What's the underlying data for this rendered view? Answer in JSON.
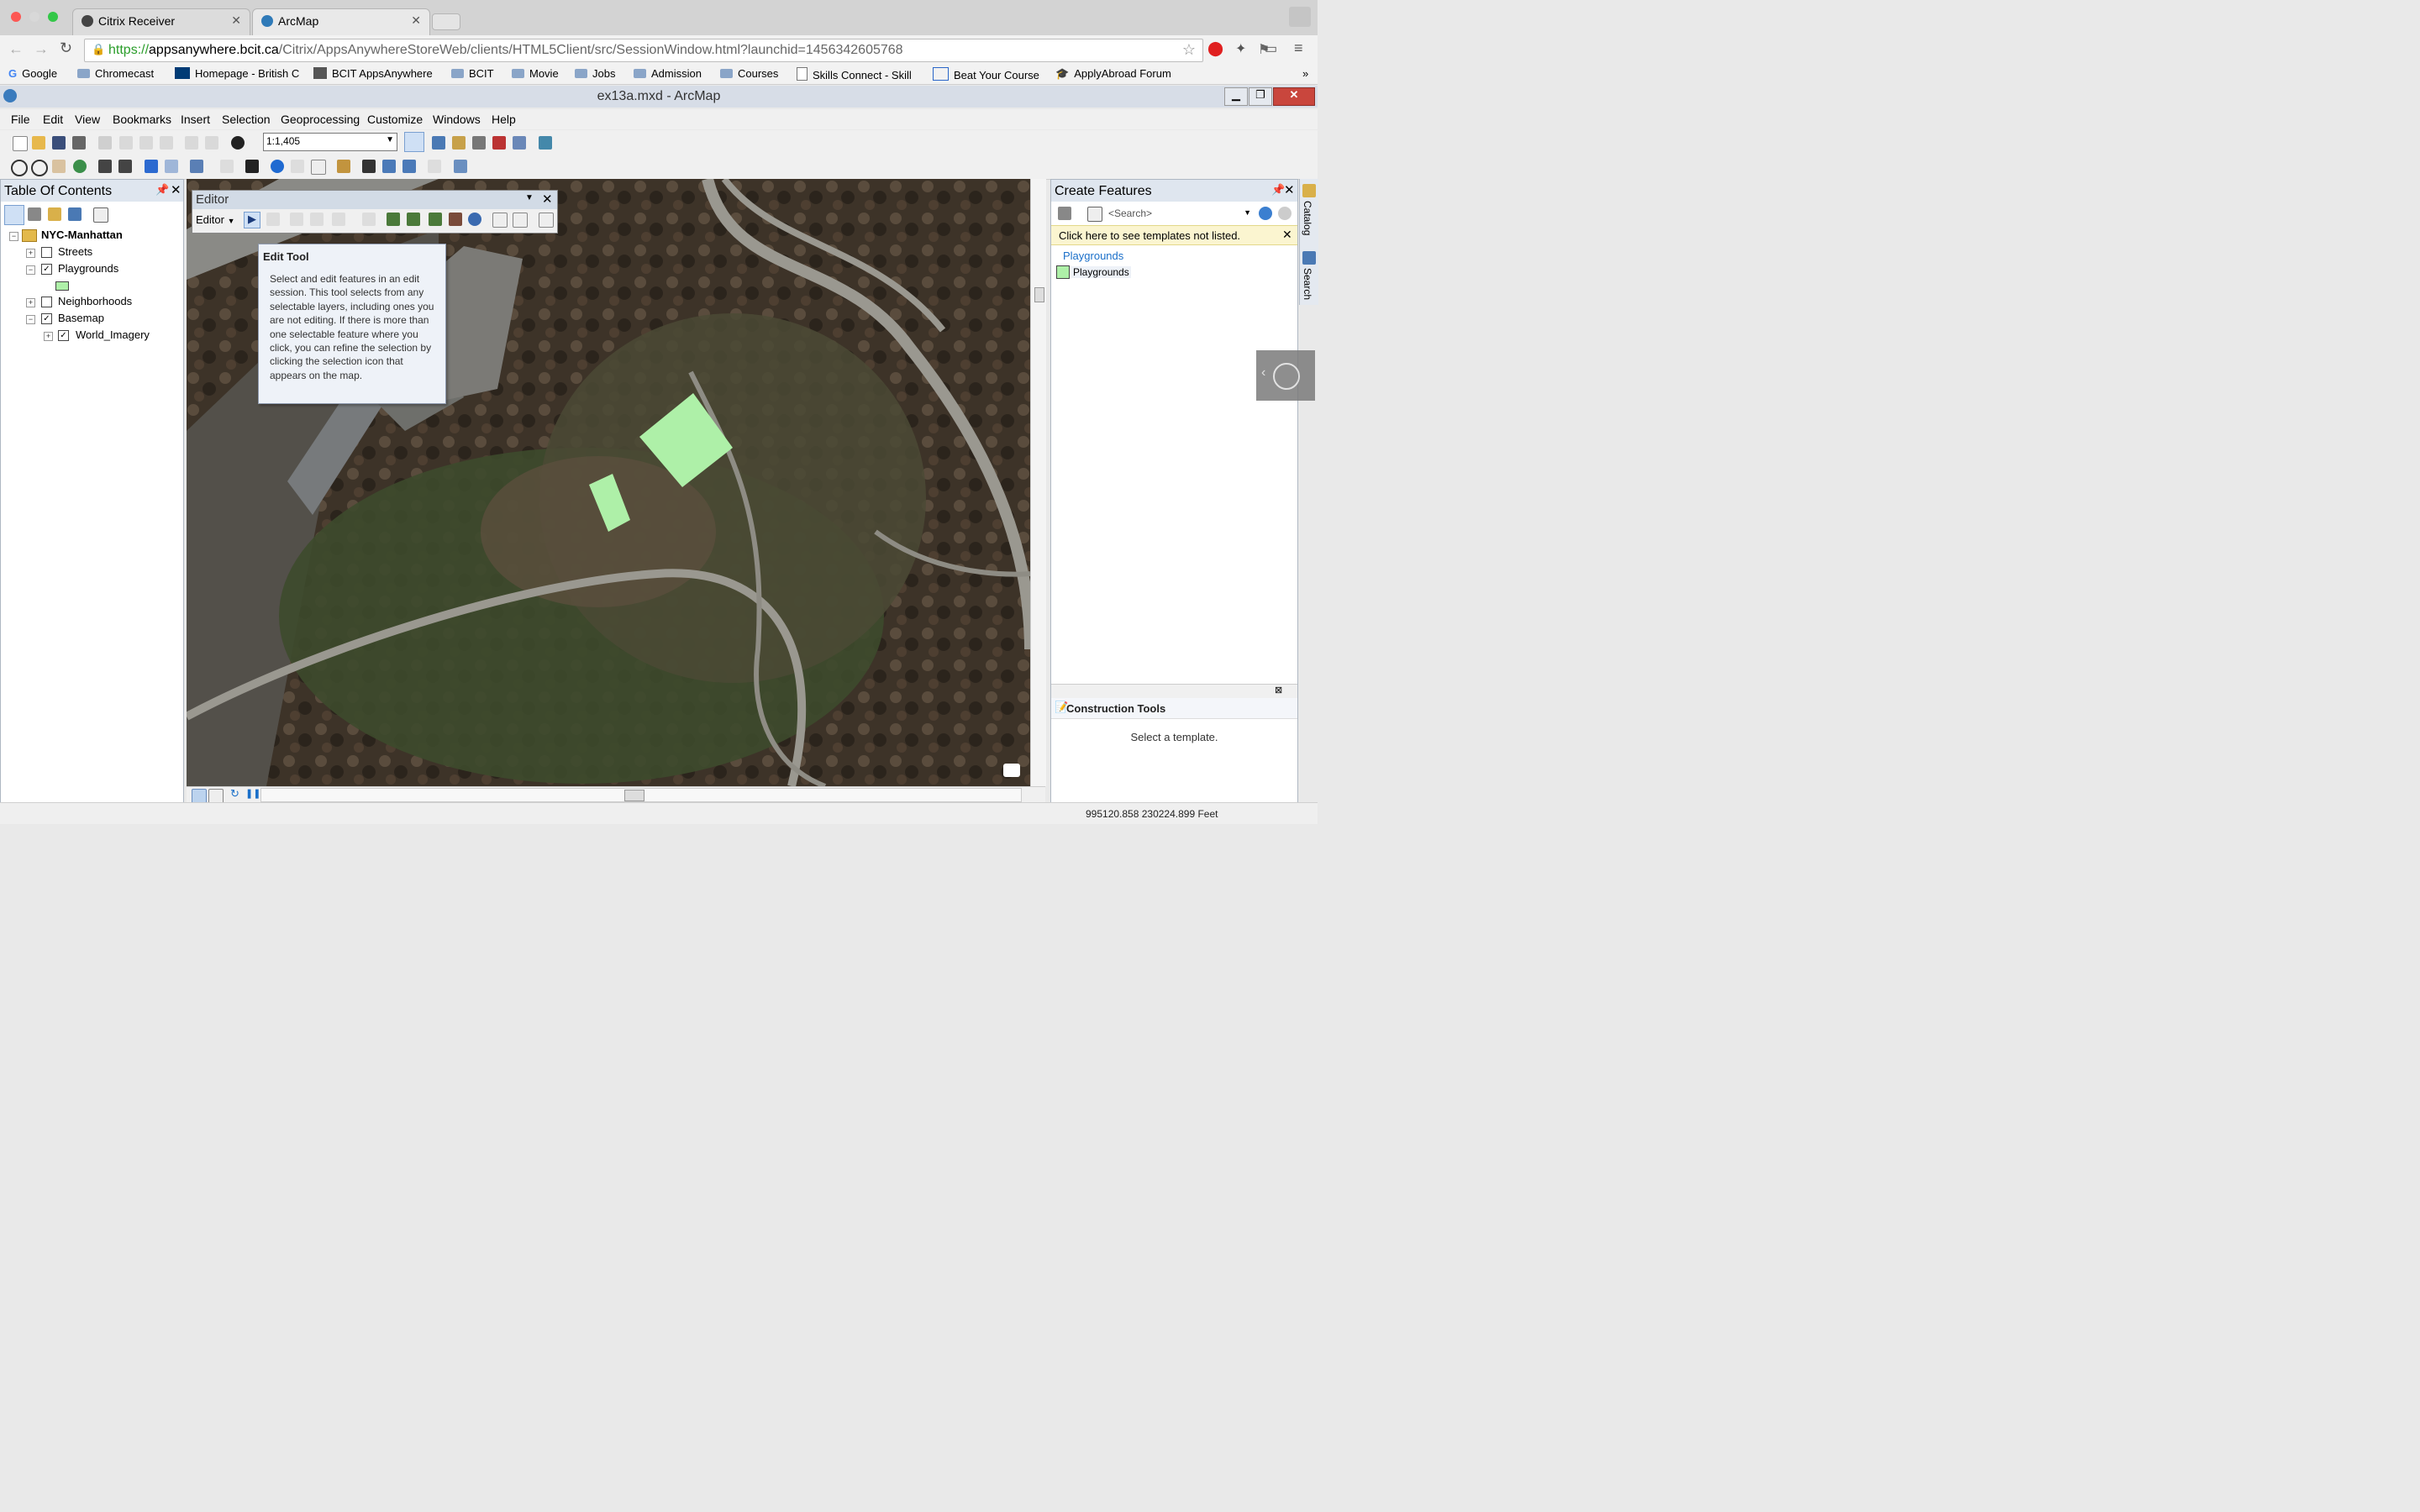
{
  "browser": {
    "tabs": [
      {
        "label": "Citrix Receiver"
      },
      {
        "label": "ArcMap"
      }
    ],
    "url": {
      "scheme": "https://",
      "host": "appsanywhere.bcit.ca",
      "path": "/Citrix/AppsAnywhereStoreWeb/clients/HTML5Client/src/SessionWindow.html?launchid=1456342605768"
    },
    "bookmarks": [
      "Google",
      "Chromecast",
      "Homepage - British C",
      "BCIT AppsAnywhere",
      "BCIT",
      "Movie",
      "Jobs",
      "Admission",
      "Courses",
      "Skills Connect - Skill",
      "Beat Your Course",
      "ApplyAbroad Forum"
    ],
    "overflow": "»"
  },
  "app": {
    "title": "ex13a.mxd - ArcMap",
    "menus": [
      "File",
      "Edit",
      "View",
      "Bookmarks",
      "Insert",
      "Selection",
      "Geoprocessing",
      "Customize",
      "Windows",
      "Help"
    ],
    "scale": "1:1,405"
  },
  "toc": {
    "title": "Table Of Contents",
    "root": "NYC-Manhattan",
    "layers": [
      {
        "name": "Streets",
        "checked": false
      },
      {
        "name": "Playgrounds",
        "checked": true
      },
      {
        "name": "Neighborhoods",
        "checked": false
      },
      {
        "name": "Basemap",
        "checked": true
      },
      {
        "name": "World_Imagery",
        "checked": true
      }
    ]
  },
  "editor": {
    "title": "Editor",
    "menu_label": "Editor",
    "tooltip_title": "Edit Tool",
    "tooltip_body": "Select and edit features in an edit session. This tool selects from any selectable layers, including ones you are not editing. If there is more than one selectable feature where you click, you can refine the selection by clicking the selection icon that appears on the map."
  },
  "create_features": {
    "title": "Create Features",
    "search_placeholder": "<Search>",
    "notice": "Click here to see templates not listed.",
    "group": "Playgrounds",
    "template": "Playgrounds",
    "construction_title": "Construction Tools",
    "construction_hint": "Select a template."
  },
  "side_tabs": [
    "Catalog",
    "Search"
  ],
  "status": {
    "coords": "995120.858  230224.899 Feet"
  },
  "colors": {
    "playground_fill": "#aef0a8",
    "accent": "#1a6fc9"
  }
}
